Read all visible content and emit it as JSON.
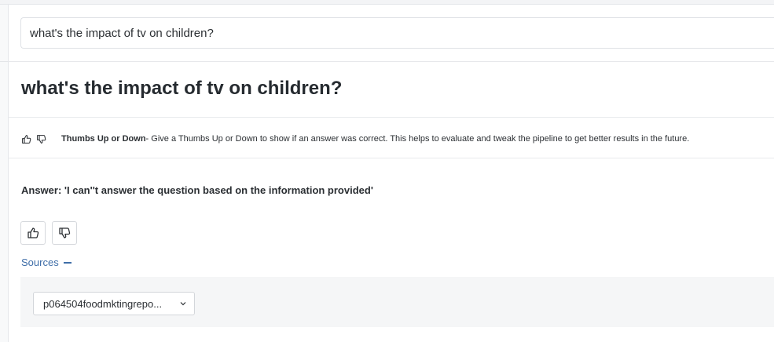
{
  "search": {
    "value": "what's the impact of tv on children?"
  },
  "result": {
    "title": "what's the impact of tv on children?"
  },
  "tip": {
    "label": "Thumbs Up or Down",
    "text": " - Give a Thumbs Up or Down to show if an answer was correct. This helps to evaluate and tweak the pipeline to get better results in the future."
  },
  "answer": {
    "text": "Answer: 'I can''t answer the question based on the information provided'"
  },
  "sources": {
    "label": "Sources",
    "selected": "p064504foodmktingrepo..."
  },
  "icons": {
    "thumbs_up": "thumbs-up-icon",
    "thumbs_down": "thumbs-down-icon",
    "chevron": "chevron-down-icon"
  },
  "colors": {
    "link": "#3f6ea8",
    "text": "#2b2f33"
  }
}
